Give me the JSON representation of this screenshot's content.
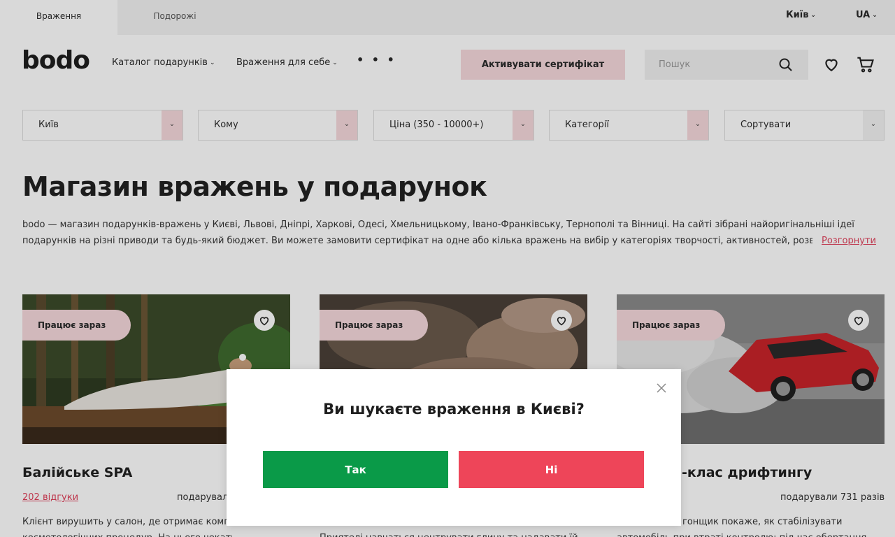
{
  "topbar": {
    "tabs": [
      {
        "label": "Враження",
        "active": true
      },
      {
        "label": "Подорожі",
        "active": false
      }
    ],
    "city": "Київ",
    "lang": "UA"
  },
  "header": {
    "logo": "bodo",
    "nav": [
      {
        "label": "Каталог подарунків"
      },
      {
        "label": "Враження для себе"
      }
    ],
    "more": "• • •",
    "activate_label": "Активувати сертифікат",
    "search_placeholder": "Пошук"
  },
  "filters": [
    {
      "label": "Київ"
    },
    {
      "label": "Кому"
    },
    {
      "label": "Ціна (350 - 10000+)"
    },
    {
      "label": "Категорії"
    },
    {
      "label": "Сортувати"
    }
  ],
  "page": {
    "title": "Магазин вражень у подарунок",
    "desc_line1": "bodo — магазин подарунків-вражень у Києві, Львові, Дніпрі, Харкові, Одесі, Хмельницькому, Івано-Франківську, Тернополі та Вінниці. На сайті зібрані найоригінальніші ідеї",
    "desc_line2": "подарунків на різні приводи та будь-який бюджет. Ви можете замовити сертифікат на одне або кілька вражень на вибір у категоріях творчості, активностей, розваг",
    "expand_label": "Розгорнути"
  },
  "cards": [
    {
      "badge": "Працює зараз",
      "title": "Балійське SPA",
      "reviews": "202 відгуки",
      "gifted": "подарували",
      "desc": "Клієнт вирушить у салон, де отримає комплекс",
      "desc2": "косметологічних процедур. На нього чекатиме пілінг"
    },
    {
      "badge": "Працює зараз",
      "title": "",
      "reviews": "",
      "gifted": "",
      "desc": "",
      "desc2": "Приятелі навчаться центрувати глину та надавати їй"
    },
    {
      "badge": "Працює зараз",
      "title": "-клас дрифтингу",
      "reviews": "",
      "gifted": "подарували 731 разів",
      "desc": "гонщик покаже, як стабілізувати",
      "desc2": "автомобіль при втраті контролю: під час обертання"
    }
  ],
  "modal": {
    "question": "Ви шукаєте враження в Києві?",
    "yes_label": "Так",
    "no_label": "Ні"
  },
  "colors": {
    "accent_pink": "#f6d9dc",
    "link_red": "#e0415b",
    "yes_green": "#0a9a48",
    "no_red": "#ee4559"
  }
}
